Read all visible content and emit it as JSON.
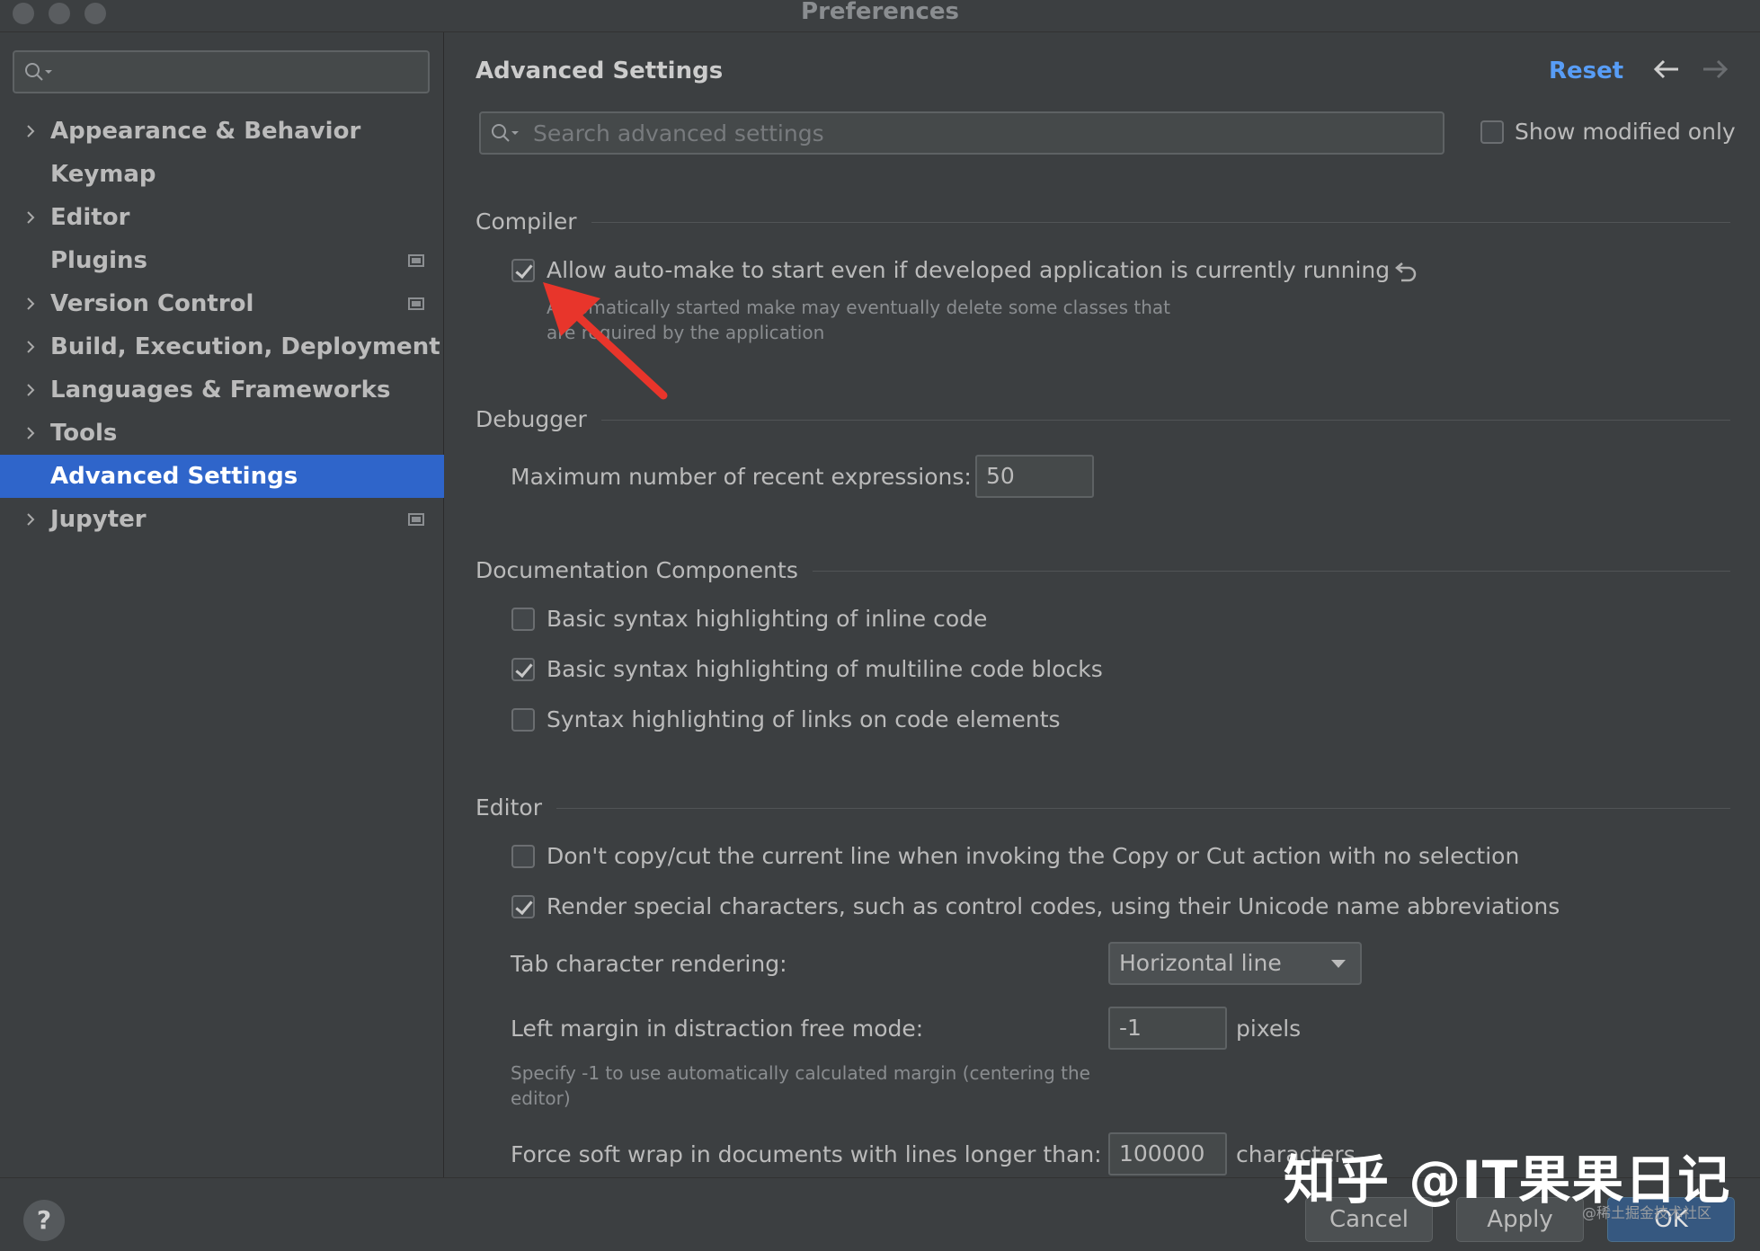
{
  "window": {
    "title": "Preferences"
  },
  "sidebar": {
    "search_placeholder": "",
    "items": [
      {
        "label": "Appearance & Behavior",
        "expandable": true,
        "pinned": false,
        "selected": false
      },
      {
        "label": "Keymap",
        "expandable": false,
        "pinned": false,
        "selected": false
      },
      {
        "label": "Editor",
        "expandable": true,
        "pinned": false,
        "selected": false
      },
      {
        "label": "Plugins",
        "expandable": false,
        "pinned": true,
        "selected": false
      },
      {
        "label": "Version Control",
        "expandable": true,
        "pinned": true,
        "selected": false
      },
      {
        "label": "Build, Execution, Deployment",
        "expandable": true,
        "pinned": false,
        "selected": false
      },
      {
        "label": "Languages & Frameworks",
        "expandable": true,
        "pinned": false,
        "selected": false
      },
      {
        "label": "Tools",
        "expandable": true,
        "pinned": false,
        "selected": false
      },
      {
        "label": "Advanced Settings",
        "expandable": false,
        "pinned": false,
        "selected": true
      },
      {
        "label": "Jupyter",
        "expandable": true,
        "pinned": true,
        "selected": false
      }
    ]
  },
  "header": {
    "title": "Advanced Settings",
    "reset_label": "Reset",
    "search_placeholder": "Search advanced settings",
    "show_modified_label": "Show modified only",
    "show_modified_checked": false
  },
  "compiler": {
    "section": "Compiler",
    "auto_make_label": "Allow auto-make to start even if developed application is currently running",
    "auto_make_checked": true,
    "hint_line1": "Automatically started make may eventually delete some classes that",
    "hint_line2": "are required by the application"
  },
  "debugger": {
    "section": "Debugger",
    "recent_label": "Maximum number of recent expressions:",
    "recent_value": "50"
  },
  "documentation": {
    "section": "Documentation Components",
    "options": [
      {
        "label": "Basic syntax highlighting of inline code",
        "checked": false
      },
      {
        "label": "Basic syntax highlighting of multiline code blocks",
        "checked": true
      },
      {
        "label": "Syntax highlighting of links on code elements",
        "checked": false
      }
    ]
  },
  "editor": {
    "section": "Editor",
    "copy_label": "Don't copy/cut the current line when invoking the Copy or Cut action with no selection",
    "copy_checked": false,
    "render_label": "Render special characters, such as control codes, using their Unicode name abbreviations",
    "render_checked": true,
    "tab_label": "Tab character rendering:",
    "tab_value": "Horizontal line",
    "margin_label": "Left margin in distraction free mode:",
    "margin_value": "-1",
    "margin_unit": "pixels",
    "margin_hint_line1": "Specify -1 to use automatically calculated margin (centering the",
    "margin_hint_line2": "editor)",
    "wrap_label": "Force soft wrap in documents with lines longer than:",
    "wrap_value": "100000",
    "wrap_unit": "characters"
  },
  "footer": {
    "help_label": "?",
    "cancel_label": "Cancel",
    "apply_label": "Apply",
    "ok_label": "OK",
    "watermark": "知乎 @IT果果日记",
    "watermark_small": "@稀土掘金技术社区"
  },
  "colors": {
    "background": "#3c3f41",
    "selection": "#2f65ca",
    "link": "#589df6",
    "annotation_arrow": "#e8352b"
  }
}
